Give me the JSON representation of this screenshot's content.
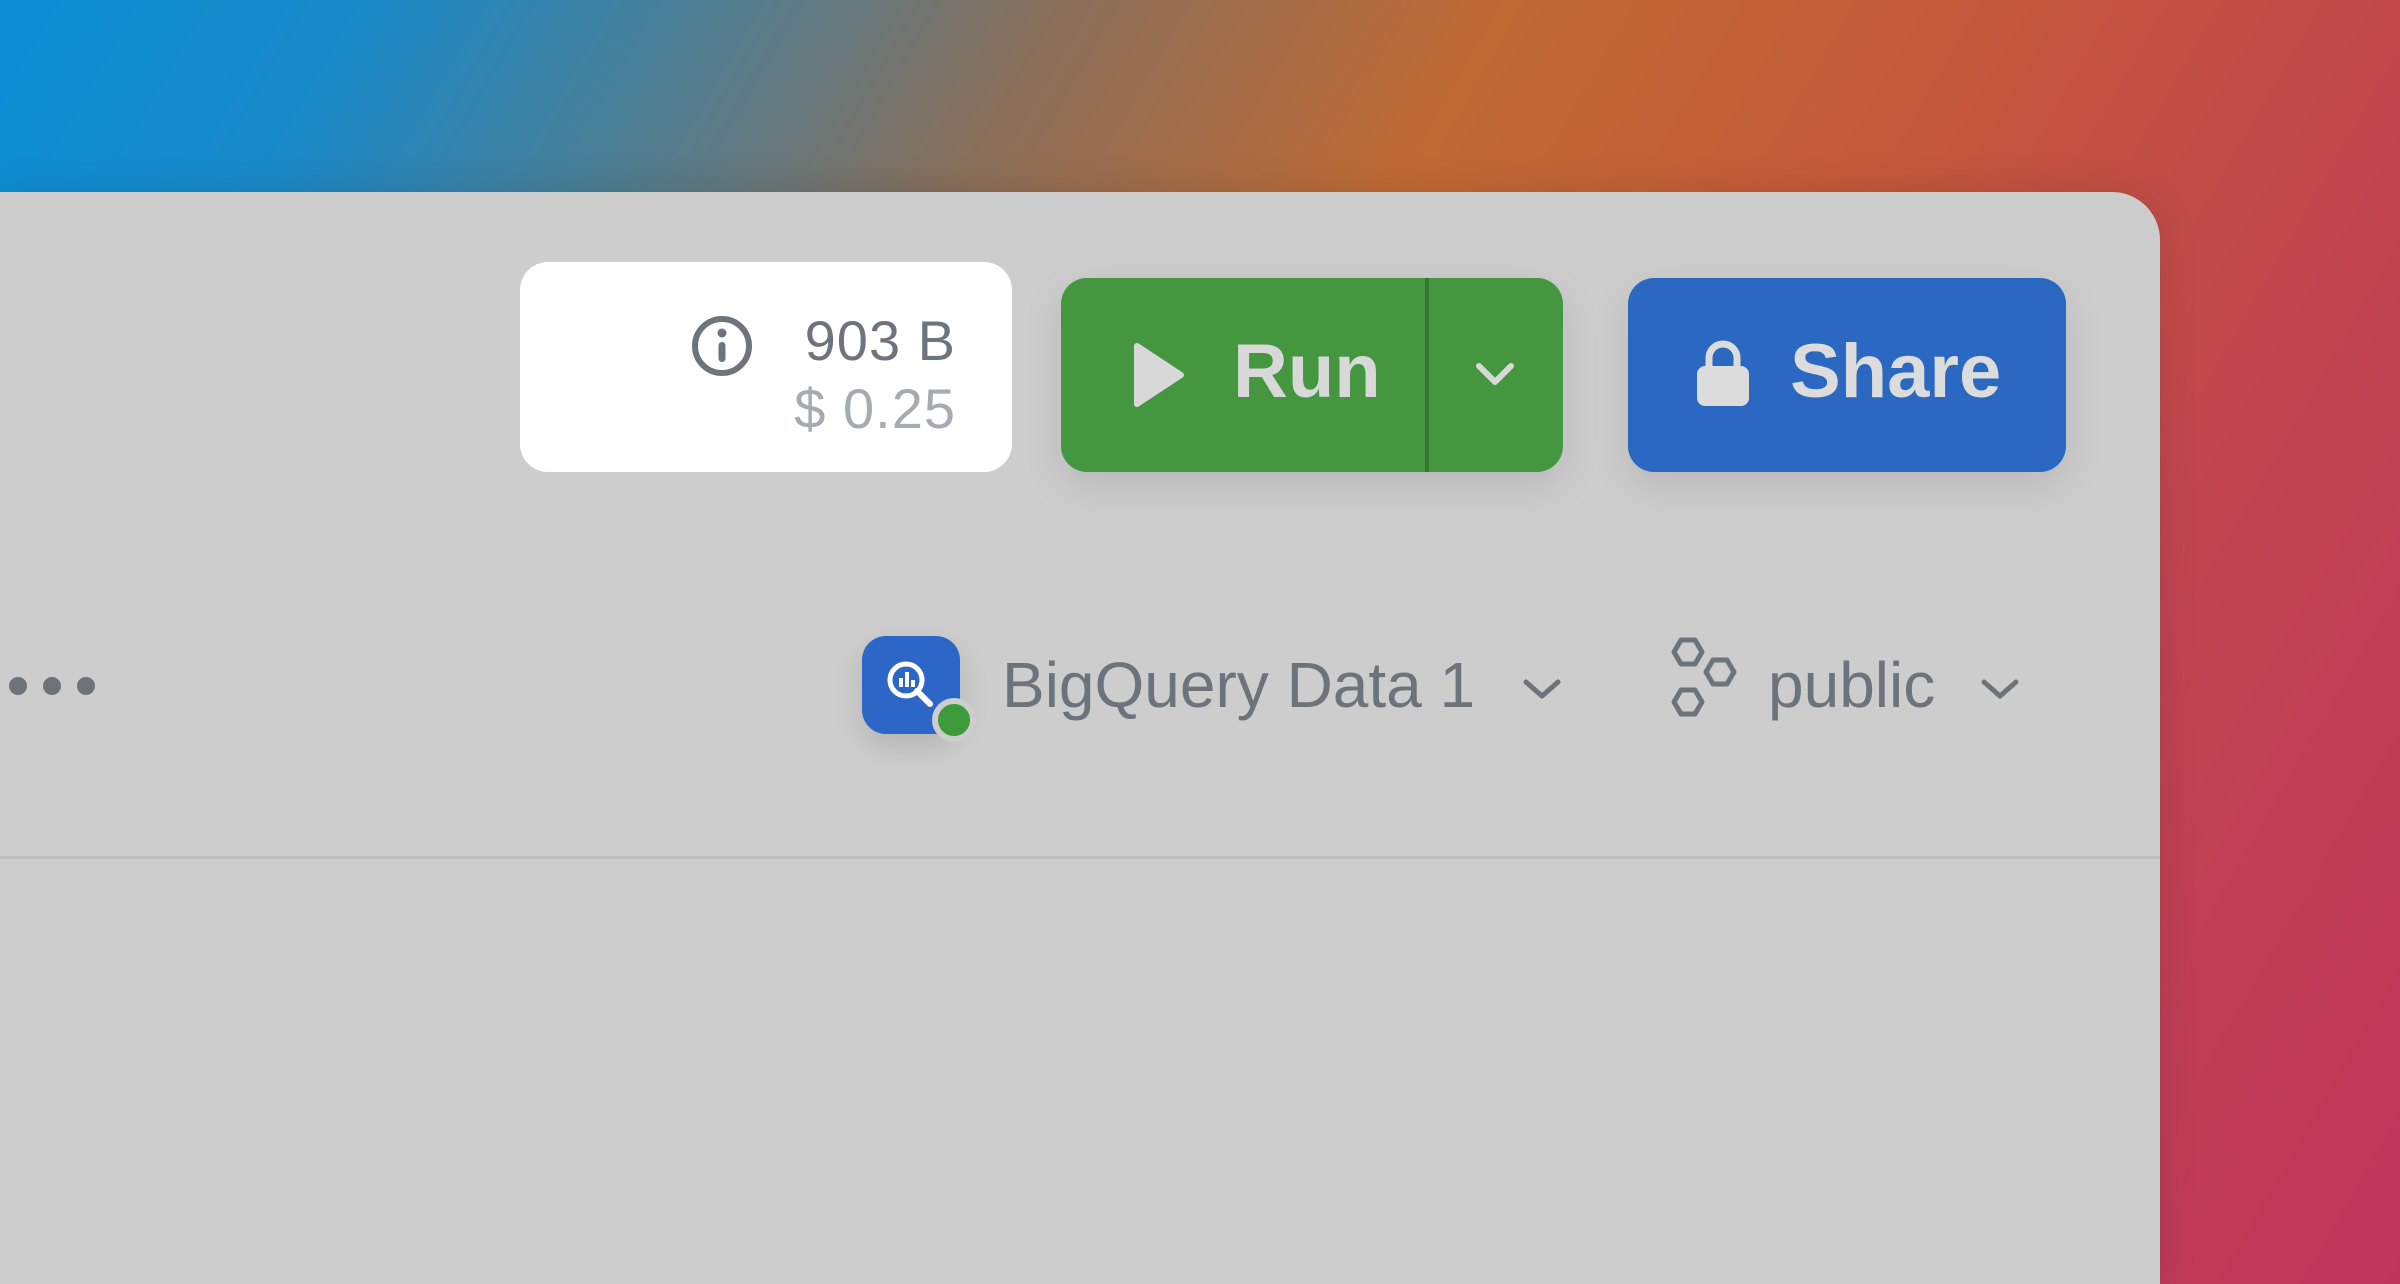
{
  "cost": {
    "size": "903 B",
    "price": "$ 0.25",
    "info_icon": "info-icon"
  },
  "run_button": {
    "label": "Run",
    "play_icon": "play-icon",
    "dropdown_icon": "chevron-down-icon",
    "color": "#44963f"
  },
  "share_button": {
    "label": "Share",
    "icon": "lock-icon",
    "color": "#2a68c1"
  },
  "more_icon": "more-horizontal-icon",
  "data_source": {
    "label": "BigQuery Data 1",
    "icon": "bigquery-logo-icon",
    "status": "connected",
    "status_color": "#3c9a3a",
    "chevron_icon": "chevron-down-icon"
  },
  "schema": {
    "label": "public",
    "icon": "hexagons-icon",
    "chevron_icon": "chevron-down-icon"
  }
}
